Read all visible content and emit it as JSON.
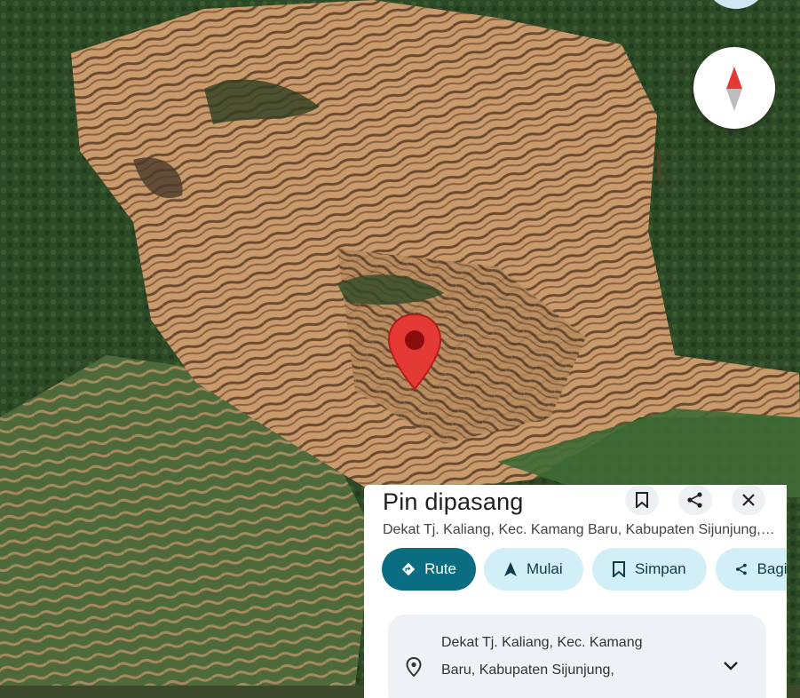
{
  "map": {
    "view": "satellite",
    "terrain_colors": [
      "#c99a6b",
      "#3f5b32",
      "#233d20",
      "#7a5a3d"
    ],
    "pin_color": "#e53935"
  },
  "compass": {
    "icon": "compass-icon"
  },
  "place_sheet": {
    "title": "Pin dipasang",
    "subtitle": "Dekat Tj. Kaliang, Kec. Kamang Baru, Kabupaten Sijunjung, Sumatera Barat",
    "header_buttons": [
      {
        "icon": "bookmark-icon"
      },
      {
        "icon": "share-icon"
      },
      {
        "icon": "close-icon"
      }
    ],
    "actions": [
      {
        "label": "Rute",
        "icon": "directions-icon",
        "style": "primary"
      },
      {
        "label": "Mulai",
        "icon": "navigate-arrow-icon",
        "style": "secondary"
      },
      {
        "label": "Simpan",
        "icon": "bookmark-icon",
        "style": "secondary"
      },
      {
        "label": "Bagikan",
        "icon": "share-icon",
        "style": "secondary"
      }
    ],
    "address_lines": [
      "Dekat Tj. Kaliang, Kec. Kamang",
      "Baru, Kabupaten Sijunjung,"
    ],
    "colors": {
      "primary": "#0b6d82",
      "secondary": "#d2eef7"
    }
  }
}
